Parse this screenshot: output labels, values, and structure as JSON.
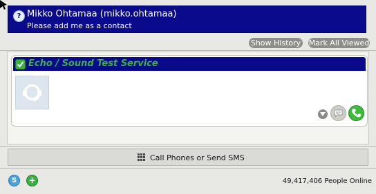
{
  "chat_request": {
    "title": "Mikko Ohtamaa (mikko.ohtamaa)",
    "message": "Please add me as a contact",
    "icon": "skype-request-icon"
  },
  "toolbar": {
    "show_history_label": "Show History",
    "mark_all_viewed_label": "Mark All Viewed"
  },
  "contact_card": {
    "title": "Echo / Sound Test Service",
    "status_icon": "online-check-icon",
    "avatar_icon": "headset-icon",
    "colors": {
      "header_bg": "#0a0a8c",
      "title_fg": "#3cb043",
      "call_green": "#3cbc3c"
    }
  },
  "call_bar": {
    "label": "Call Phones or Send SMS",
    "icon": "dialpad-icon"
  },
  "status_bar": {
    "online_count": "49,417,406 People Online"
  }
}
